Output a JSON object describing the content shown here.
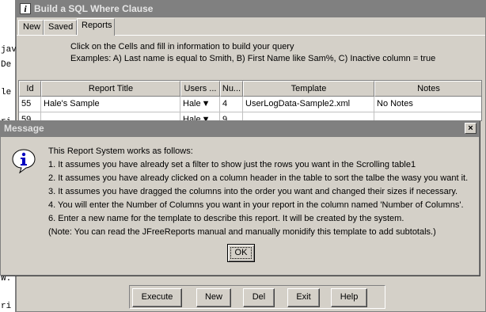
{
  "background_editor": {
    "lines": [
      "jav",
      "De",
      "le",
      "ri",
      "W.",
      "ri"
    ]
  },
  "window": {
    "title": "Build a SQL Where Clause",
    "tabs": [
      {
        "label": "New"
      },
      {
        "label": "Saved"
      },
      {
        "label": "Reports",
        "active": true
      }
    ],
    "instructions": [
      "Click on the Cells and fill in information to build your query",
      "Examples: A) Last name is equal to Smith, B) First Name like Sam%, C) Inactive column = true"
    ],
    "table": {
      "columns": [
        "Id",
        "Report Title",
        "Users ...",
        "Nu...",
        "Template",
        "Notes"
      ],
      "rows": [
        [
          "55",
          "Hale's Sample",
          "Hale",
          "4",
          "UserLogData-Sample2.xml",
          "No Notes"
        ],
        [
          "59",
          "",
          "Hale",
          "9",
          "",
          ""
        ]
      ]
    },
    "buttons": [
      {
        "label": "Execute"
      },
      {
        "label": "New"
      },
      {
        "label": "Del"
      },
      {
        "label": "Exit"
      },
      {
        "label": "Help"
      }
    ]
  },
  "dialog": {
    "title": "Message",
    "close_glyph": "×",
    "icon": "information-icon",
    "lines": [
      "This Report System works as follows:",
      "1.  It assumes you have already set a filter to show just the rows you want in the Scrolling table1",
      "2.  It assumes you have already clicked on a column header in the table to sort the talbe the wasy you want it.",
      "3.  It assumes you have dragged the columns into the order you want and changed their sizes if necessary.",
      "4.  You will enter the Number of Columns you want in your report in the column named 'Number of Columns'.",
      "6.  Enter a new name for the template to describe this report.  It will be created by the system.",
      "(Note:  You can read the JFreeReports manual and manually monidify this template to add subtotals.)"
    ],
    "ok_label": "OK"
  }
}
